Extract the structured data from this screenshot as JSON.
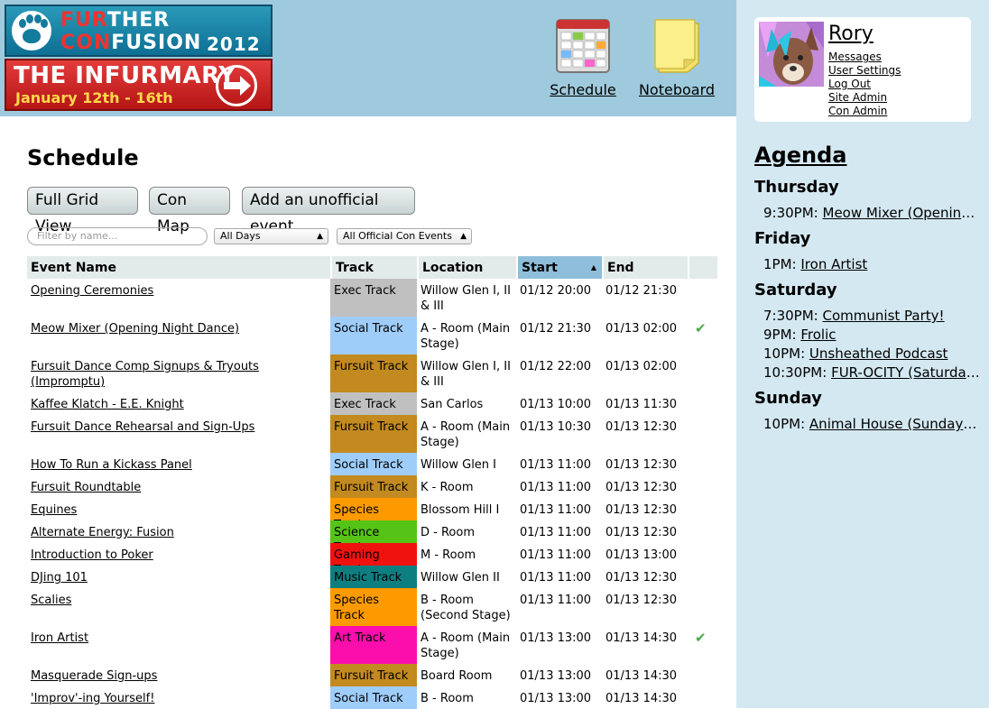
{
  "logo": {
    "fur_hi": "FUR",
    "fur_rest": "THER",
    "con_hi": "CON",
    "con_rest": "FUSION",
    "year": "2012",
    "title": "THE INFURMARY",
    "dates": "January 12th - 16th"
  },
  "nav": {
    "schedule": "Schedule",
    "noteboard": "Noteboard"
  },
  "main": {
    "title": "Schedule",
    "buttons": {
      "grid": "Full Grid View",
      "map": "Con Map",
      "add": "Add an unofficial event"
    },
    "filter_placeholder": "Filter by name...",
    "days_select": "All Days",
    "events_select": "All Official Con Events"
  },
  "table": {
    "headers": {
      "name": "Event Name",
      "track": "Track",
      "location": "Location",
      "start": "Start",
      "end": "End"
    },
    "rows": [
      {
        "name": "Opening Ceremonies",
        "track": "Exec Track",
        "track_color": "#c0c0c0",
        "track_text": "#000",
        "location": "Willow Glen I, II & III",
        "start": "01/12 20:00",
        "end": "01/12 21:30",
        "check": ""
      },
      {
        "name": "Meow Mixer (Opening Night Dance)",
        "track": "Social Track",
        "track_color": "#9fcdfa",
        "track_text": "#000",
        "location": "A - Room (Main Stage)",
        "start": "01/12 21:30",
        "end": "01/13 02:00",
        "check": "✔"
      },
      {
        "name": "Fursuit Dance Comp Signups & Tryouts (Impromptu)",
        "track": "Fursuit Track",
        "track_color": "#c28a1f",
        "track_text": "#000",
        "location": "Willow Glen I, II & III",
        "start": "01/12 22:00",
        "end": "01/13 02:00",
        "check": ""
      },
      {
        "name": "Kaffee Klatch - E.E. Knight",
        "track": "Exec Track",
        "track_color": "#c0c0c0",
        "track_text": "#000",
        "location": "San Carlos",
        "start": "01/13 10:00",
        "end": "01/13 11:30",
        "check": ""
      },
      {
        "name": "Fursuit Dance Rehearsal and Sign-Ups",
        "track": "Fursuit Track",
        "track_color": "#c28a1f",
        "track_text": "#000",
        "location": "A - Room (Main Stage)",
        "start": "01/13 10:30",
        "end": "01/13 12:30",
        "check": ""
      },
      {
        "name": "How To Run a Kickass Panel",
        "track": "Social Track",
        "track_color": "#9fcdfa",
        "track_text": "#000",
        "location": "Willow Glen I",
        "start": "01/13 11:00",
        "end": "01/13 12:30",
        "check": ""
      },
      {
        "name": "Fursuit Roundtable",
        "track": "Fursuit Track",
        "track_color": "#c28a1f",
        "track_text": "#000",
        "location": "K - Room",
        "start": "01/13 11:00",
        "end": "01/13 12:30",
        "check": ""
      },
      {
        "name": "Equines",
        "track": "Species Track",
        "track_color": "#fd9a00",
        "track_text": "#000",
        "location": "Blossom Hill I",
        "start": "01/13 11:00",
        "end": "01/13 12:30",
        "check": ""
      },
      {
        "name": "Alternate Energy: Fusion",
        "track": "Science Track",
        "track_color": "#55c416",
        "track_text": "#000",
        "location": "D - Room",
        "start": "01/13 11:00",
        "end": "01/13 12:30",
        "check": ""
      },
      {
        "name": "Introduction to Poker",
        "track": "Gaming Track",
        "track_color": "#f0120f",
        "track_text": "#000",
        "location": "M - Room",
        "start": "01/13 11:00",
        "end": "01/13 13:00",
        "check": ""
      },
      {
        "name": "DJing 101",
        "track": "Music Track",
        "track_color": "#0e7f80",
        "track_text": "#000",
        "location": "Willow Glen II",
        "start": "01/13 11:00",
        "end": "01/13 12:30",
        "check": ""
      },
      {
        "name": "Scalies",
        "track": "Species Track",
        "track_color": "#fd9a00",
        "track_text": "#000",
        "location": "B - Room (Second Stage)",
        "start": "01/13 11:00",
        "end": "01/13 12:30",
        "check": ""
      },
      {
        "name": "Iron Artist",
        "track": "Art Track",
        "track_color": "#fb0eac",
        "track_text": "#000",
        "location": "A - Room (Main Stage)",
        "start": "01/13 13:00",
        "end": "01/13 14:30",
        "check": "✔"
      },
      {
        "name": "Masquerade Sign-ups",
        "track": "Fursuit Track",
        "track_color": "#c28a1f",
        "track_text": "#000",
        "location": "Board Room",
        "start": "01/13 13:00",
        "end": "01/13 14:30",
        "check": ""
      },
      {
        "name": "'Improv'-ing Yourself!",
        "track": "Social Track",
        "track_color": "#9fcdfa",
        "track_text": "#000",
        "location": "B - Room",
        "start": "01/13 13:00",
        "end": "01/13 14:30",
        "check": ""
      }
    ]
  },
  "user": {
    "name": "Rory",
    "links": [
      "Messages",
      "User Settings",
      "Log Out",
      "Site Admin",
      "Con Admin"
    ]
  },
  "agenda": {
    "title": "Agenda",
    "days": [
      {
        "day": "Thursday",
        "items": [
          {
            "time": "9:30PM:",
            "event": "Meow Mixer (Opening Night Dance)"
          }
        ]
      },
      {
        "day": "Friday",
        "items": [
          {
            "time": "1PM:",
            "event": "Iron Artist"
          }
        ]
      },
      {
        "day": "Saturday",
        "items": [
          {
            "time": "7:30PM:",
            "event": "Communist Party!"
          },
          {
            "time": "9PM:",
            "event": "Frolic"
          },
          {
            "time": "10PM:",
            "event": "Unsheathed Podcast"
          },
          {
            "time": "10:30PM:",
            "event": "FUR-OCITY (Saturday Night Dance)"
          }
        ]
      },
      {
        "day": "Sunday",
        "items": [
          {
            "time": "10PM:",
            "event": "Animal House (Sunday Night Dance)"
          }
        ]
      }
    ]
  }
}
